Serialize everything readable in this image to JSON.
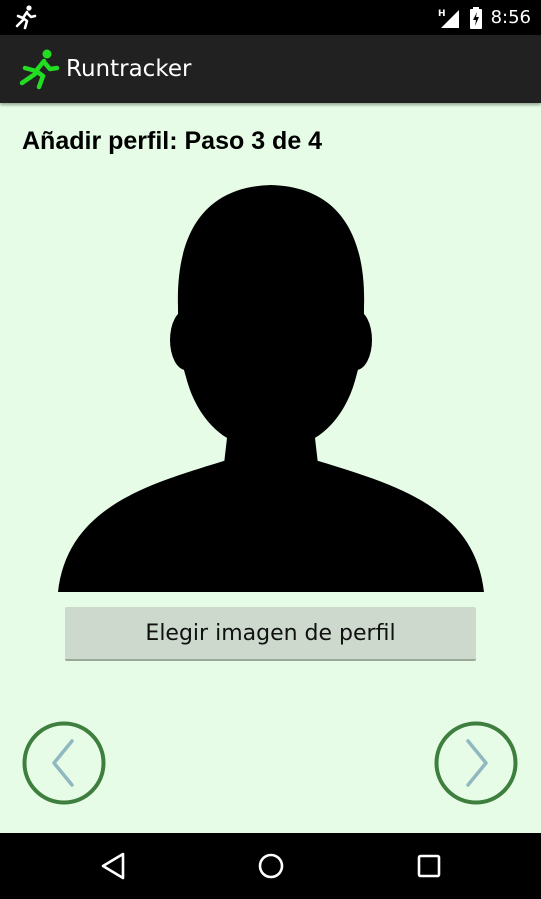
{
  "status_bar": {
    "time": "8:56",
    "network": "H",
    "icons": [
      "running-man-icon",
      "signal-icon",
      "battery-charging-icon"
    ]
  },
  "app_bar": {
    "title": "Runtracker",
    "logo_icon": "running-man-logo-icon",
    "logo_color": "#22dd22"
  },
  "page": {
    "title": "Añadir perfil: Paso 3 de 4",
    "avatar_icon": "person-silhouette-icon",
    "choose_image_label": "Elegir imagen de perfil"
  },
  "navigation": {
    "prev_icon": "chevron-left-icon",
    "next_icon": "chevron-right-icon",
    "circle_color": "#3e7e3e",
    "chevron_color": "#90b8c0"
  },
  "system_nav": {
    "icons": [
      "back-icon",
      "home-icon",
      "recents-icon"
    ]
  },
  "colors": {
    "background": "#e6fce6",
    "app_bar": "#212121",
    "button": "#ccd9cc"
  }
}
